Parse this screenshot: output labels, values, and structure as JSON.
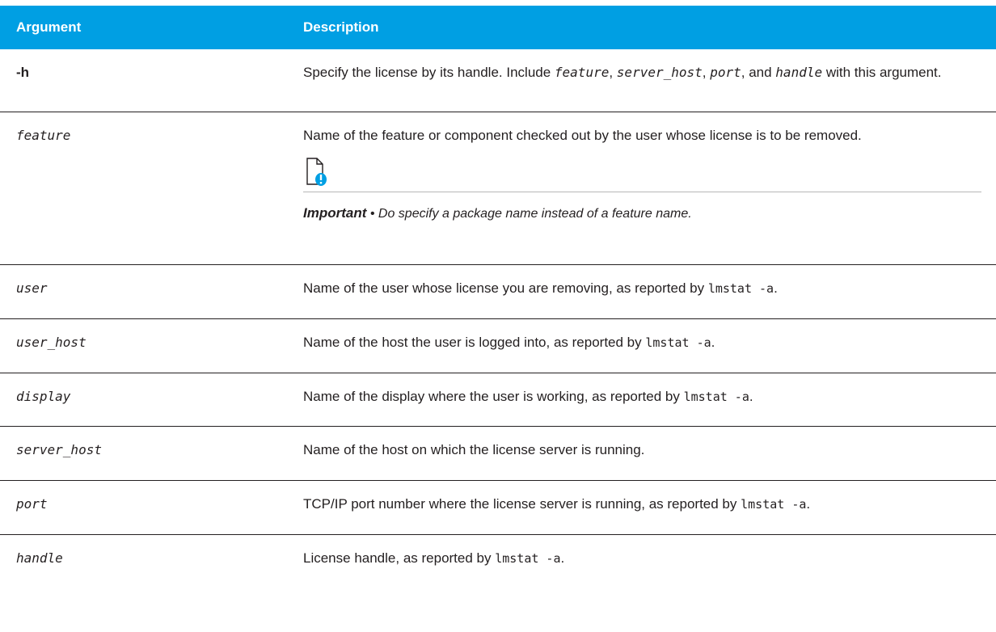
{
  "table": {
    "headers": {
      "argument": "Argument",
      "description": "Description"
    },
    "rows": [
      {
        "arg": "-h",
        "desc": {
          "p1": "Specify the license by its handle. Include ",
          "feature": "feature",
          "c1": ", ",
          "server_host": "server_host",
          "c2": ", ",
          "port": "port",
          "c3": ", and ",
          "handle": "handle",
          "p2": " with this argument."
        }
      },
      {
        "arg": "feature",
        "desc": {
          "text": "Name of the feature or component checked out by the user whose license is to be removed.",
          "note_lead": "Important",
          "note_bullet": " • ",
          "note_text": "Do specify a package name instead of a feature name."
        }
      },
      {
        "arg": "user",
        "desc": {
          "text": "Name of the user whose license you are removing, as reported by ",
          "code": "lmstat -a",
          "end": "."
        }
      },
      {
        "arg": "user_host",
        "desc": {
          "text": "Name of the host the user is logged into, as reported by ",
          "code": "lmstat -a",
          "end": "."
        }
      },
      {
        "arg": "display",
        "desc": {
          "text": "Name of the display where the user is working, as reported by ",
          "code": "lmstat -a",
          "end": "."
        }
      },
      {
        "arg": "server_host",
        "desc": {
          "text": "Name of the host on which the license server is running."
        }
      },
      {
        "arg": "port",
        "desc": {
          "text": "TCP/IP port number where the license server is running, as reported by ",
          "code": "lmstat -a",
          "end": "."
        }
      },
      {
        "arg": "handle",
        "desc": {
          "text": "License handle, as reported by ",
          "code": "lmstat -a",
          "end": "."
        }
      }
    ]
  },
  "colors": {
    "header_bg": "#009fe3",
    "note_icon_accent": "#009fe3"
  },
  "icons": {
    "note": "note-important-icon"
  }
}
